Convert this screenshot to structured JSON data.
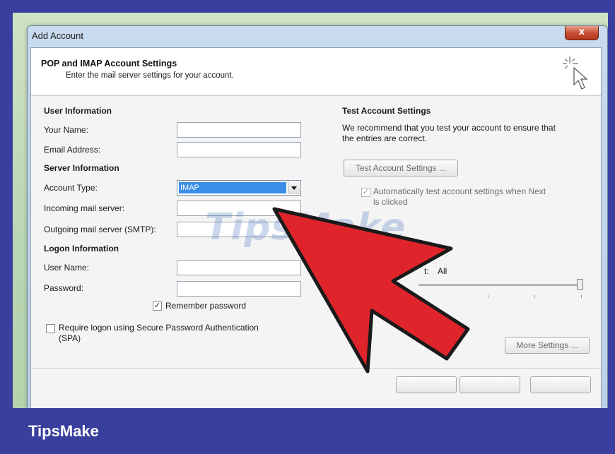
{
  "window": {
    "title": "Add Account",
    "close_label": "x"
  },
  "header": {
    "title": "POP and IMAP Account Settings",
    "subtitle": "Enter the mail server settings for your account."
  },
  "user_info": {
    "heading": "User Information",
    "your_name_label": "Your Name:",
    "your_name_value": "",
    "email_label": "Email Address:",
    "email_value": ""
  },
  "server_info": {
    "heading": "Server Information",
    "account_type_label": "Account Type:",
    "account_type_value": "IMAP",
    "incoming_label": "Incoming mail server:",
    "incoming_value": "",
    "outgoing_label": "Outgoing mail server (SMTP):",
    "outgoing_value": ""
  },
  "logon_info": {
    "heading": "Logon Information",
    "username_label": "User Name:",
    "username_value": "",
    "password_label": "Password:",
    "password_value": "",
    "remember_label": "Remember password",
    "remember_checked": true,
    "spa_label_line1": "Require logon using Secure Password Authentication",
    "spa_label_line2": "(SPA)",
    "spa_checked": false
  },
  "test_settings": {
    "heading": "Test Account Settings",
    "description_line1": "We recommend that you test your account to ensure that",
    "description_line2": "the entries are correct.",
    "test_button": "Test Account Settings ...",
    "auto_test_line1": "Automatically test account settings when Next",
    "auto_test_line2": "is clicked",
    "auto_test_checked": true,
    "partial_label": "t:",
    "all_label": "All",
    "more_settings_button": "More Settings ..."
  },
  "watermark": "TipsMake",
  "banner": {
    "text": "TipsMake"
  },
  "colors": {
    "frame": "#3a3f9e",
    "selection": "#3a8ee8",
    "arrow_fill": "#e0242b"
  }
}
